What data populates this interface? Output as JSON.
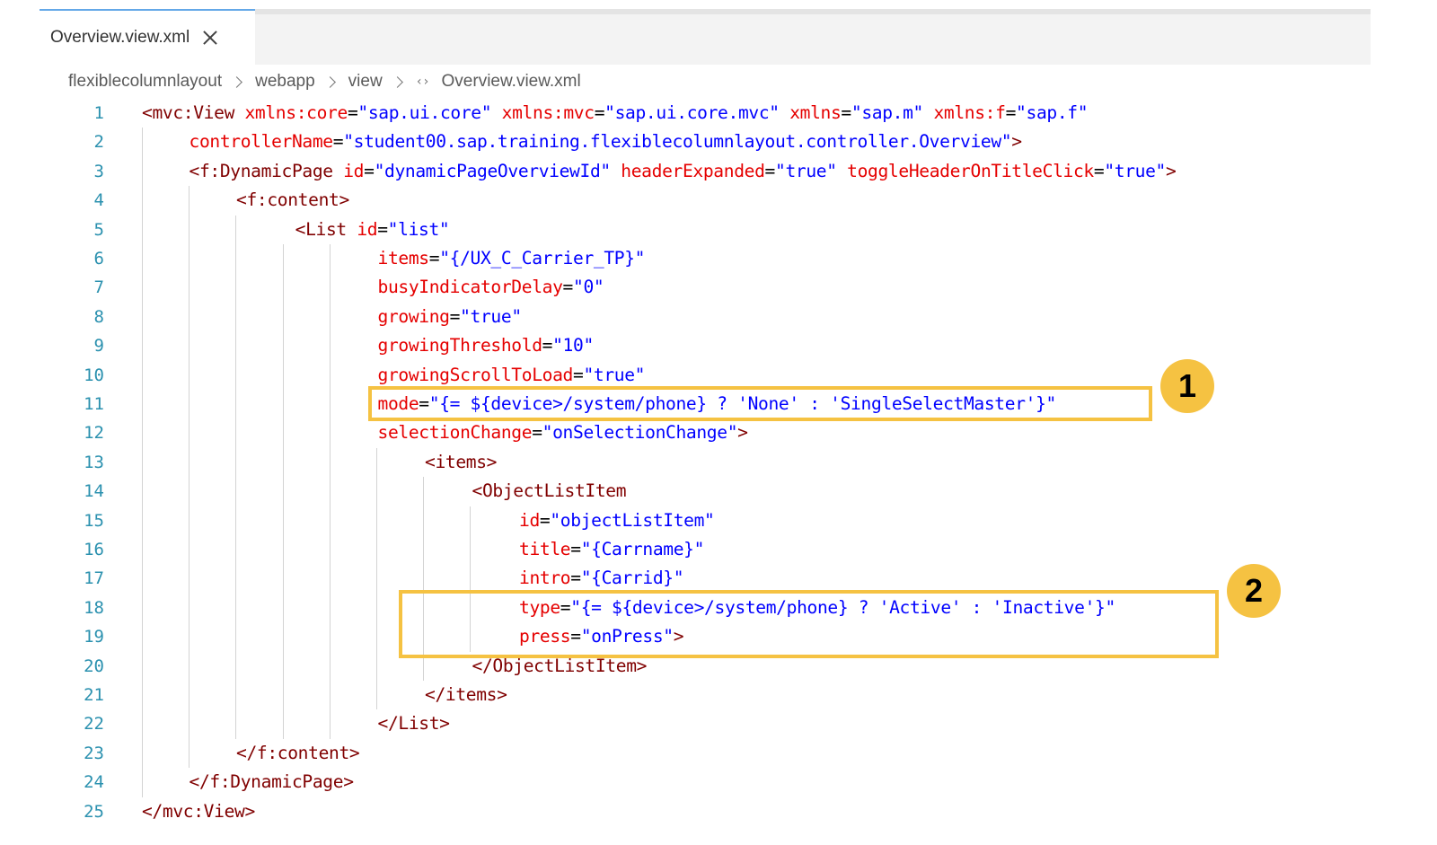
{
  "tab": {
    "label": "Overview.view.xml"
  },
  "breadcrumb": [
    "flexiblecolumnlayout",
    "webapp",
    "view",
    "Overview.view.xml"
  ],
  "code_lines": [
    {
      "n": "1",
      "indent": 0,
      "parts": [
        [
          "tag",
          "<mvc:View "
        ],
        [
          "attr",
          "xmlns:core"
        ],
        [
          "pun",
          "="
        ],
        [
          "val",
          "\"sap.ui.core\" "
        ],
        [
          "attr",
          "xmlns:mvc"
        ],
        [
          "pun",
          "="
        ],
        [
          "val",
          "\"sap.ui.core.mvc\" "
        ],
        [
          "attr",
          "xmlns"
        ],
        [
          "pun",
          "="
        ],
        [
          "val",
          "\"sap.m\" "
        ],
        [
          "attr",
          "xmlns:f"
        ],
        [
          "pun",
          "="
        ],
        [
          "val",
          "\"sap.f\""
        ]
      ]
    },
    {
      "n": "2",
      "indent": 1,
      "parts": [
        [
          "attr",
          "controllerName"
        ],
        [
          "pun",
          "="
        ],
        [
          "val",
          "\"student00.sap.training.flexiblecolumnlayout.controller.Overview\""
        ],
        [
          "tag",
          ">"
        ]
      ]
    },
    {
      "n": "3",
      "indent": 1,
      "parts": [
        [
          "tag",
          "<f:DynamicPage "
        ],
        [
          "attr",
          "id"
        ],
        [
          "pun",
          "="
        ],
        [
          "val",
          "\"dynamicPageOverviewId\" "
        ],
        [
          "attr",
          "headerExpanded"
        ],
        [
          "pun",
          "="
        ],
        [
          "val",
          "\"true\" "
        ],
        [
          "attr",
          "toggleHeaderOnTitleClick"
        ],
        [
          "pun",
          "="
        ],
        [
          "val",
          "\"true\""
        ],
        [
          "tag",
          ">"
        ]
      ]
    },
    {
      "n": "4",
      "indent": 2,
      "parts": [
        [
          "tag",
          "<f:content>"
        ]
      ]
    },
    {
      "n": "5",
      "indent": 3.25,
      "parts": [
        [
          "tag",
          "<List "
        ],
        [
          "attr",
          "id"
        ],
        [
          "pun",
          "="
        ],
        [
          "val",
          "\"list\""
        ]
      ]
    },
    {
      "n": "6",
      "indent": 5,
      "parts": [
        [
          "attr",
          "items"
        ],
        [
          "pun",
          "="
        ],
        [
          "val",
          "\"{/UX_C_Carrier_TP}\""
        ]
      ]
    },
    {
      "n": "7",
      "indent": 5,
      "parts": [
        [
          "attr",
          "busyIndicatorDelay"
        ],
        [
          "pun",
          "="
        ],
        [
          "val",
          "\"0\""
        ]
      ]
    },
    {
      "n": "8",
      "indent": 5,
      "parts": [
        [
          "attr",
          "growing"
        ],
        [
          "pun",
          "="
        ],
        [
          "val",
          "\"true\""
        ]
      ]
    },
    {
      "n": "9",
      "indent": 5,
      "parts": [
        [
          "attr",
          "growingThreshold"
        ],
        [
          "pun",
          "="
        ],
        [
          "val",
          "\"10\""
        ]
      ]
    },
    {
      "n": "10",
      "indent": 5,
      "parts": [
        [
          "attr",
          "growingScrollToLoad"
        ],
        [
          "pun",
          "="
        ],
        [
          "val",
          "\"true\""
        ]
      ]
    },
    {
      "n": "11",
      "indent": 5,
      "parts": [
        [
          "attr",
          "mode"
        ],
        [
          "pun",
          "="
        ],
        [
          "val",
          "\"{= ${device>/system/phone} ? 'None' : 'SingleSelectMaster'}\""
        ]
      ]
    },
    {
      "n": "12",
      "indent": 5,
      "parts": [
        [
          "attr",
          "selectionChange"
        ],
        [
          "pun",
          "="
        ],
        [
          "val",
          "\"onSelectionChange\""
        ],
        [
          "tag",
          ">"
        ]
      ]
    },
    {
      "n": "13",
      "indent": 6,
      "parts": [
        [
          "tag",
          "<items>"
        ]
      ]
    },
    {
      "n": "14",
      "indent": 7,
      "parts": [
        [
          "tag",
          "<ObjectListItem"
        ]
      ]
    },
    {
      "n": "15",
      "indent": 8,
      "parts": [
        [
          "attr",
          "id"
        ],
        [
          "pun",
          "="
        ],
        [
          "val",
          "\"objectListItem\""
        ]
      ]
    },
    {
      "n": "16",
      "indent": 8,
      "parts": [
        [
          "attr",
          "title"
        ],
        [
          "pun",
          "="
        ],
        [
          "val",
          "\"{Carrname}\""
        ]
      ]
    },
    {
      "n": "17",
      "indent": 8,
      "parts": [
        [
          "attr",
          "intro"
        ],
        [
          "pun",
          "="
        ],
        [
          "val",
          "\"{Carrid}\""
        ]
      ]
    },
    {
      "n": "18",
      "indent": 8,
      "parts": [
        [
          "attr",
          "type"
        ],
        [
          "pun",
          "="
        ],
        [
          "val",
          "\"{= ${device>/system/phone} ? 'Active' : 'Inactive'}\""
        ]
      ]
    },
    {
      "n": "19",
      "indent": 8,
      "parts": [
        [
          "attr",
          "press"
        ],
        [
          "pun",
          "="
        ],
        [
          "val",
          "\"onPress\""
        ],
        [
          "tag",
          ">"
        ]
      ]
    },
    {
      "n": "20",
      "indent": 7,
      "parts": [
        [
          "tag",
          "</ObjectListItem>"
        ]
      ]
    },
    {
      "n": "21",
      "indent": 6,
      "parts": [
        [
          "tag",
          "</items>"
        ]
      ]
    },
    {
      "n": "22",
      "indent": 5,
      "parts": [
        [
          "tag",
          "</List>"
        ]
      ]
    },
    {
      "n": "23",
      "indent": 2,
      "parts": [
        [
          "tag",
          "</f:content>"
        ]
      ]
    },
    {
      "n": "24",
      "indent": 1,
      "parts": [
        [
          "tag",
          "</f:DynamicPage>"
        ]
      ]
    },
    {
      "n": "25",
      "indent": 0,
      "parts": [
        [
          "tag",
          "</mvc:View>"
        ]
      ]
    }
  ],
  "callouts": [
    {
      "label": "1"
    },
    {
      "label": "2"
    }
  ],
  "colors": {
    "highlight": "#f5c242",
    "tag": "#800000",
    "attribute": "#e50000",
    "value": "#0000ff",
    "line_number": "#2b91af"
  }
}
